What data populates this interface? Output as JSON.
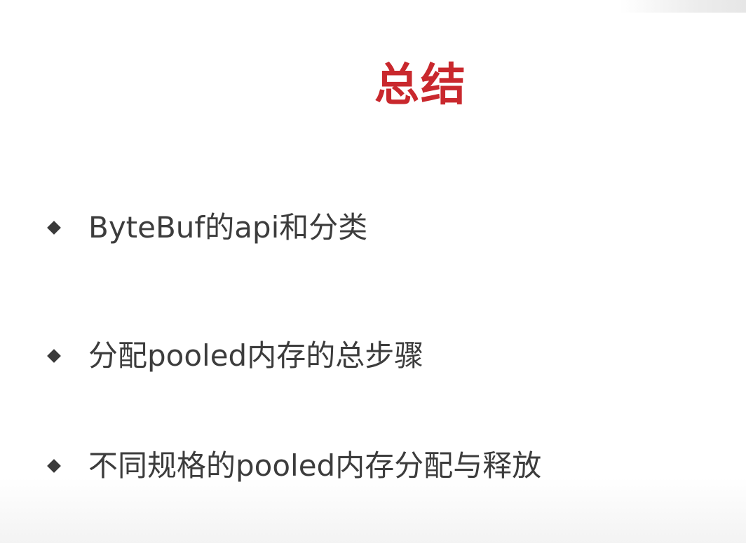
{
  "slide": {
    "title": "总结",
    "bullets": [
      "ByteBuf的api和分类",
      "分配pooled内存的总步骤",
      "不同规格的pooled内存分配与释放"
    ]
  },
  "colors": {
    "title": "#c9282d",
    "bullet_text": "#3c3c3c",
    "bullet_marker": "#3a3a3a",
    "background": "#ffffff"
  },
  "icons": {
    "bullet_marker": "diamond-bullet-icon"
  }
}
